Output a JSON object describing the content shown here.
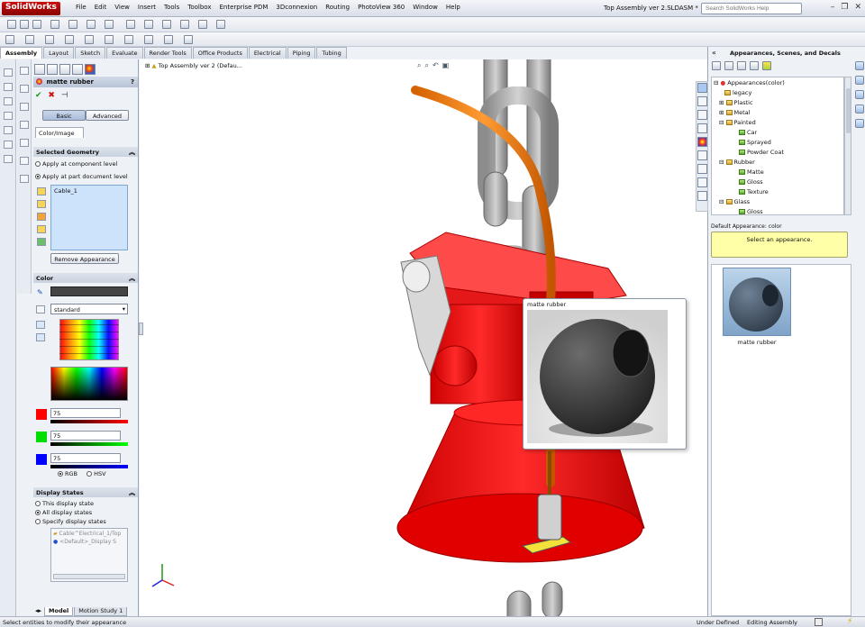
{
  "app": {
    "logo": "SolidWorks",
    "menu": [
      "File",
      "Edit",
      "View",
      "Insert",
      "Tools",
      "Toolbox",
      "Enterprise PDM",
      "3Dconnexion",
      "Routing",
      "PhotoView 360",
      "Window",
      "Help"
    ],
    "title": "Top Assembly ver 2.SLDASM *",
    "search_placeholder": "Search SolidWorks Help"
  },
  "tabs": [
    "Assembly",
    "Layout",
    "Sketch",
    "Evaluate",
    "Render Tools",
    "Office Products",
    "Electrical",
    "Piping",
    "Tubing"
  ],
  "tree_root": "Top Assembly ver 2  (Defau...",
  "pm": {
    "title": "matte rubber",
    "help": "?",
    "mode_basic": "Basic",
    "mode_advanced": "Advanced",
    "color_image_tab": "Color/Image",
    "selected_geometry": {
      "header": "Selected Geometry",
      "opt_component": "Apply at component level",
      "opt_part": "Apply at part document level",
      "item": "Cable_1",
      "remove_btn": "Remove Appearance"
    },
    "color": {
      "header": "Color",
      "swatch": "#444444",
      "palette": "standard",
      "r": "75",
      "g": "75",
      "b": "75",
      "mode_rgb": "RGB",
      "mode_hsv": "HSV"
    },
    "display_states": {
      "header": "Display States",
      "opt_this": "This display state",
      "opt_all": "All display states",
      "opt_specify": "Specify display states",
      "list": [
        "Cable^Electrical_1/Top",
        "<Default>_Display S"
      ]
    }
  },
  "preview": {
    "title": "matte rubber"
  },
  "right_panel": {
    "header": "Appearances, Scenes, and Decals",
    "tree": [
      {
        "label": "Appearances(color)",
        "lvl": 0
      },
      {
        "label": "legacy",
        "lvl": 1
      },
      {
        "label": "Plastic",
        "lvl": 1
      },
      {
        "label": "Metal",
        "lvl": 1
      },
      {
        "label": "Painted",
        "lvl": 1
      },
      {
        "label": "Car",
        "lvl": 2
      },
      {
        "label": "Sprayed",
        "lvl": 2
      },
      {
        "label": "Powder Coat",
        "lvl": 2
      },
      {
        "label": "Rubber",
        "lvl": 1
      },
      {
        "label": "Matte",
        "lvl": 2
      },
      {
        "label": "Gloss",
        "lvl": 2
      },
      {
        "label": "Texture",
        "lvl": 2
      },
      {
        "label": "Glass",
        "lvl": 1
      },
      {
        "label": "Gloss",
        "lvl": 2
      }
    ],
    "default_appearance": "Default Appearance: color",
    "hint": "Select an appearance.",
    "thumb_label": "matte rubber"
  },
  "bottom_tabs": [
    "Model",
    "Motion Study 1"
  ],
  "status": {
    "left": "Select entities to modify their appearance",
    "state1": "Under Defined",
    "state2": "Editing Assembly"
  }
}
